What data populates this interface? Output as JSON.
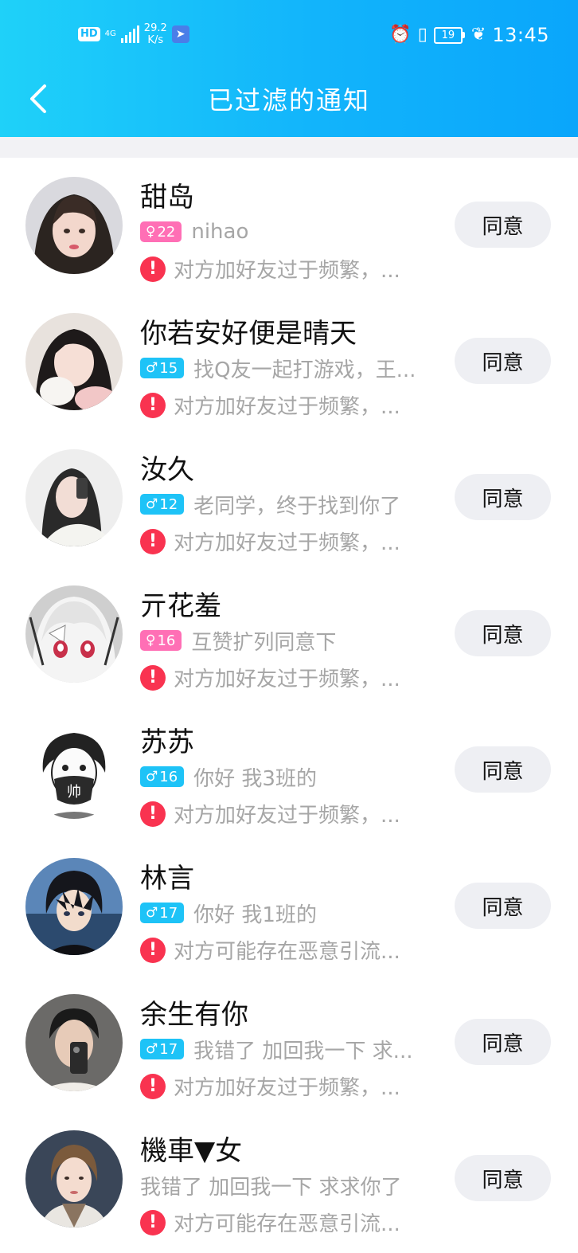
{
  "status_bar": {
    "hd": "HD",
    "network": "4G",
    "net_speed_value": "29.2",
    "net_speed_unit": "K/s",
    "battery": "19",
    "time": "13:45",
    "icons": [
      "alarm-icon",
      "vibrate-icon",
      "battery-icon",
      "leaf-icon",
      "signal-icon",
      "app-notification-icon"
    ]
  },
  "header": {
    "title": "已过滤的通知",
    "back_icon": "chevron-left-icon"
  },
  "colors": {
    "header_start": "#1fd1f9",
    "header_end": "#0aa6fb",
    "female_tag": "#ff6fb5",
    "male_tag": "#1ec3f7",
    "warning": "#f93350",
    "button_bg": "#eeeff3"
  },
  "requests": [
    {
      "name": "甜岛",
      "gender": "female",
      "gender_symbol": "♀",
      "age": "22",
      "message": "nihao",
      "warning": "对方加好友过于频繁，...",
      "button": "同意"
    },
    {
      "name": "你若安好便是晴天",
      "gender": "male",
      "gender_symbol": "♂",
      "age": "15",
      "message": "找Q友一起打游戏，王...",
      "warning": "对方加好友过于频繁，...",
      "button": "同意"
    },
    {
      "name": "汝久",
      "gender": "male",
      "gender_symbol": "♂",
      "age": "12",
      "message": "老同学，终于找到你了",
      "warning": "对方加好友过于频繁，...",
      "button": "同意"
    },
    {
      "name": "亓花羞",
      "gender": "female",
      "gender_symbol": "♀",
      "age": "16",
      "message": "互赞扩列同意下",
      "warning": "对方加好友过于频繁，...",
      "button": "同意"
    },
    {
      "name": "苏苏",
      "gender": "male",
      "gender_symbol": "♂",
      "age": "16",
      "message": "你好 我3班的",
      "warning": "对方加好友过于频繁，...",
      "button": "同意"
    },
    {
      "name": "林言",
      "gender": "male",
      "gender_symbol": "♂",
      "age": "17",
      "message": "你好 我1班的",
      "warning": "对方可能存在恶意引流...",
      "button": "同意"
    },
    {
      "name": "余生有你",
      "gender": "male",
      "gender_symbol": "♂",
      "age": "17",
      "message": "我错了 加回我一下 求...",
      "warning": "对方加好友过于频繁，...",
      "button": "同意"
    },
    {
      "name": "機車▼女",
      "gender": "",
      "gender_symbol": "",
      "age": "",
      "message": "我错了 加回我一下 求求你了",
      "warning": "对方可能存在恶意引流...",
      "button": "同意"
    }
  ]
}
